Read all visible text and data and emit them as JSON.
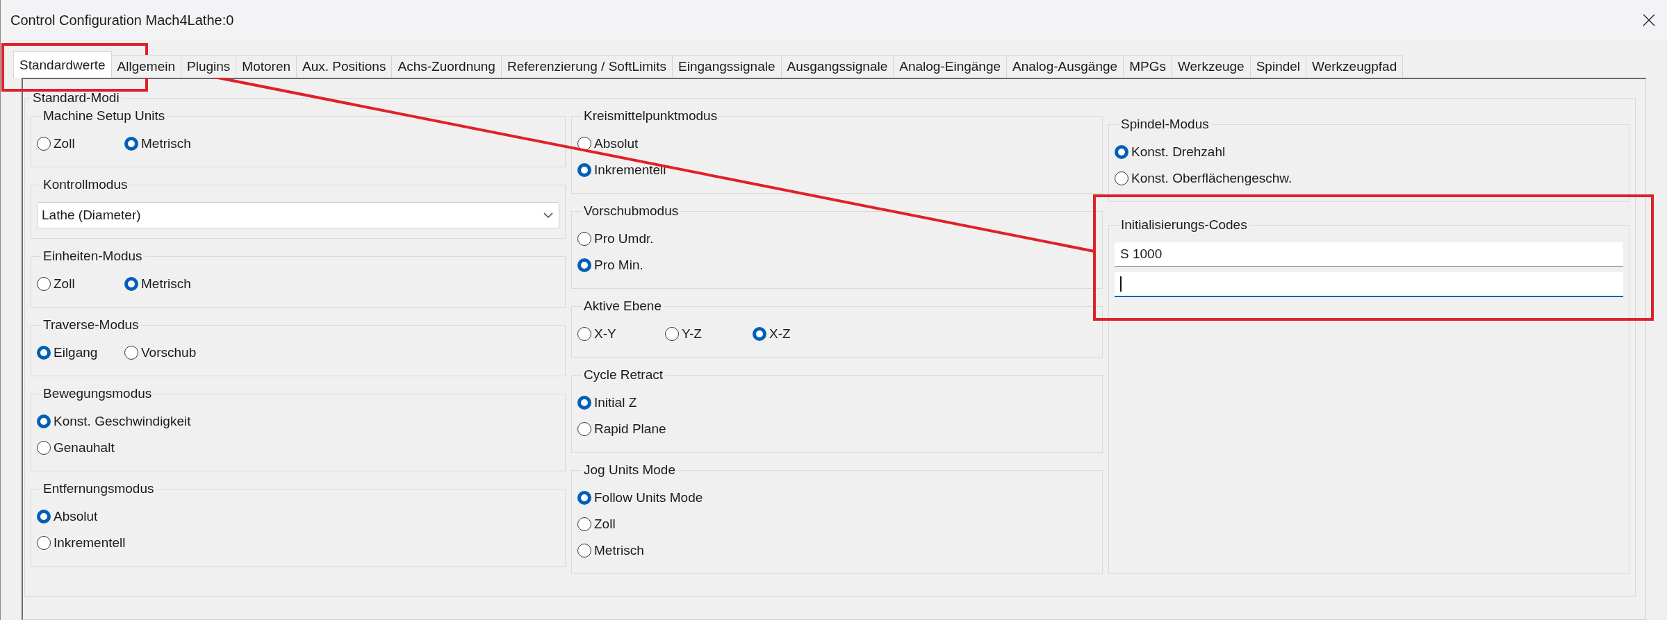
{
  "window": {
    "title": "Control Configuration Mach4Lathe:0"
  },
  "tabs": [
    {
      "label": "Standardwerte",
      "selected": true
    },
    {
      "label": "Allgemein",
      "selected": false
    },
    {
      "label": "Plugins",
      "selected": false
    },
    {
      "label": "Motoren",
      "selected": false
    },
    {
      "label": "Aux. Positions",
      "selected": false
    },
    {
      "label": "Achs-Zuordnung",
      "selected": false
    },
    {
      "label": "Referenzierung / SoftLimits",
      "selected": false
    },
    {
      "label": "Eingangssignale",
      "selected": false
    },
    {
      "label": "Ausgangssignale",
      "selected": false
    },
    {
      "label": "Analog-Eingänge",
      "selected": false
    },
    {
      "label": "Analog-Ausgänge",
      "selected": false
    },
    {
      "label": "MPGs",
      "selected": false
    },
    {
      "label": "Werkzeuge",
      "selected": false
    },
    {
      "label": "Spindel",
      "selected": false
    },
    {
      "label": "Werkzeugpfad",
      "selected": false
    }
  ],
  "panel": {
    "title": "Standard-Modi",
    "columns": [
      [
        {
          "title": "Machine Setup Units",
          "kind": "inline",
          "options": [
            {
              "label": "Zoll",
              "selected": false
            },
            {
              "label": "Metrisch",
              "selected": true
            }
          ]
        },
        {
          "title": "Kontrollmodus",
          "kind": "dropdown",
          "value": "Lathe (Diameter)"
        },
        {
          "title": "Einheiten-Modus",
          "kind": "inline",
          "options": [
            {
              "label": "Zoll",
              "selected": false
            },
            {
              "label": "Metrisch",
              "selected": true
            }
          ]
        },
        {
          "title": "Traverse-Modus",
          "kind": "inline",
          "options": [
            {
              "label": "Eilgang",
              "selected": true
            },
            {
              "label": "Vorschub",
              "selected": false
            }
          ]
        },
        {
          "title": "Bewegungsmodus",
          "kind": "radio",
          "options": [
            {
              "label": "Konst. Geschwindigkeit",
              "selected": true
            },
            {
              "label": "Genauhalt",
              "selected": false
            }
          ]
        },
        {
          "title": "Entfernungsmodus",
          "kind": "radio",
          "options": [
            {
              "label": "Absolut",
              "selected": true
            },
            {
              "label": "Inkrementell",
              "selected": false
            }
          ]
        }
      ],
      [
        {
          "title": "Kreismittelpunktmodus",
          "kind": "radio",
          "options": [
            {
              "label": "Absolut",
              "selected": false
            },
            {
              "label": "Inkrementell",
              "selected": true
            }
          ]
        },
        {
          "title": "Vorschubmodus",
          "kind": "radio",
          "options": [
            {
              "label": "Pro Umdr.",
              "selected": false
            },
            {
              "label": "Pro Min.",
              "selected": true
            }
          ]
        },
        {
          "title": "Aktive Ebene",
          "kind": "inline",
          "options": [
            {
              "label": "X-Y",
              "selected": false
            },
            {
              "label": "Y-Z",
              "selected": false
            },
            {
              "label": "X-Z",
              "selected": true
            }
          ]
        },
        {
          "title": "Cycle Retract",
          "kind": "radio",
          "options": [
            {
              "label": "Initial Z",
              "selected": true
            },
            {
              "label": "Rapid Plane",
              "selected": false
            }
          ]
        },
        {
          "title": "Jog Units Mode",
          "kind": "radio",
          "options": [
            {
              "label": "Follow Units Mode",
              "selected": true
            },
            {
              "label": "Zoll",
              "selected": false
            },
            {
              "label": "Metrisch",
              "selected": false
            }
          ]
        }
      ],
      [
        {
          "title": "Spindel-Modus",
          "kind": "radio",
          "options": [
            {
              "label": "Konst. Drehzahl",
              "selected": true
            },
            {
              "label": "Konst. Oberflächengeschw.",
              "selected": false
            }
          ]
        },
        {
          "title": "Initialisierungs-Codes",
          "kind": "codes",
          "entries": [
            {
              "value": "S 1000",
              "focused": false
            },
            {
              "focused": true
            }
          ]
        }
      ]
    ]
  }
}
